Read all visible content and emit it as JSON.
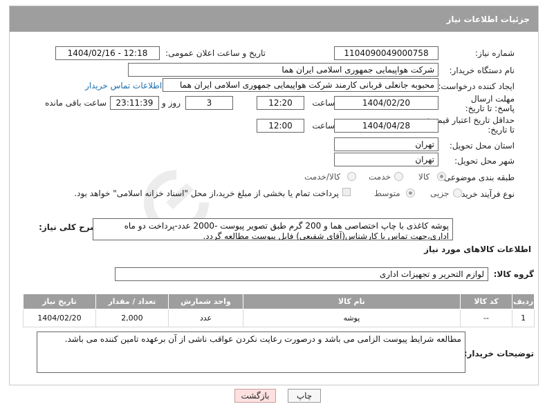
{
  "header": {
    "title": "جزئیات اطلاعات نیاز"
  },
  "fields": {
    "need_number": {
      "label": "شماره نیاز:",
      "value": "1104090049000758"
    },
    "announce_datetime": {
      "label": "تاریخ و ساعت اعلان عمومی:",
      "value": "1404/02/16 - 12:18"
    },
    "buyer_org": {
      "label": "نام دستگاه خریدار:",
      "value": "شرکت هواپیمایی جمهوری اسلامی ایران هما"
    },
    "requester": {
      "label": "ایجاد کننده درخواست:",
      "value": "محبوبه جانعلی قربانی کارمند شرکت هواپیمایی جمهوری اسلامی ایران هما",
      "contact_link": "اطلاعات تماس خریدار"
    },
    "response_deadline": {
      "label": "مهلت ارسال پاسخ: تا تاریخ:",
      "date": "1404/02/20",
      "time_label": "ساعت",
      "time": "12:20",
      "days": "3",
      "days_label": "روز و",
      "remaining": "23:11:39",
      "remaining_label": "ساعت باقی مانده"
    },
    "price_validity": {
      "label": "حداقل تاریخ اعتبار قیمت: تا تاریخ:",
      "date": "1404/04/28",
      "time_label": "ساعت",
      "time": "12:00"
    },
    "delivery_province": {
      "label": "استان محل تحویل:",
      "value": "تهران"
    },
    "delivery_city": {
      "label": "شهر محل تحویل:",
      "value": "تهران"
    },
    "category": {
      "label": "طبقه بندی موضوعی:",
      "options": [
        "کالا",
        "خدمت",
        "کالا/خدمت"
      ],
      "selected": "کالا"
    },
    "process": {
      "label": "نوع فرآیند خرید :",
      "options": [
        "جزیی",
        "متوسط"
      ],
      "selected": "متوسط",
      "payment_note": "پرداخت تمام یا بخشی از مبلغ خرید،از محل \"اسناد خزانه اسلامی\" خواهد بود."
    }
  },
  "description": {
    "label": "شرح کلی نیاز:",
    "text": "پوشه کاغذی با چاپ اختصاصی هما و 200 گرم طبق تصویر پیوست -2000 عدد-پرداخت دو ماه اداری،جهت تماس با کارشناس(آقای شفیعی) فایل پیوست مطالعه گردد."
  },
  "goods_section": {
    "title": "اطلاعات کالاهای مورد نیاز",
    "group_label": "گروه کالا:",
    "group_value": "لوازم التحریر و تجهیزات اداری"
  },
  "table": {
    "headers": [
      "ردیف",
      "کد کالا",
      "نام کالا",
      "واحد شمارش",
      "تعداد / مقدار",
      "تاریخ نیاز"
    ],
    "rows": [
      [
        "1",
        "--",
        "پوشه",
        "عدد",
        "2,000",
        "1404/02/20"
      ]
    ]
  },
  "buyer_notes": {
    "label": "توضیحات خریدار:",
    "text": "مطالعه شرایط پیوست الزامی می باشد و درصورت رعایت نکردن عواقب ناشی از آن برعهده تامین کننده می باشد."
  },
  "buttons": {
    "print": "چاپ",
    "back": "بازگشت"
  },
  "colors": {
    "header_bg": "#9e9e9e",
    "link": "#1a6fb0",
    "back_button_bg": "#fde0e0"
  }
}
